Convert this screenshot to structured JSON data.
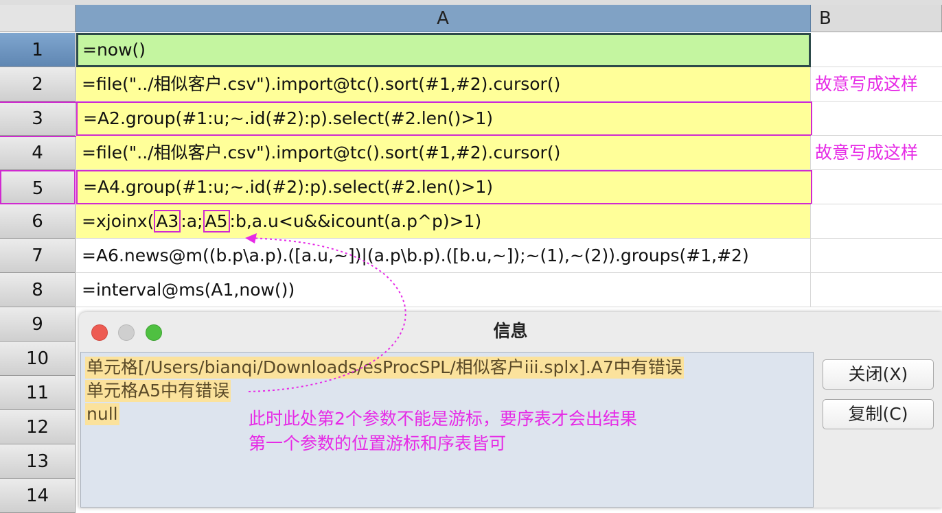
{
  "sheet": {
    "columns": [
      "A",
      "B"
    ],
    "rows": [
      {
        "num": "1",
        "formula": "=now()",
        "note": ""
      },
      {
        "num": "2",
        "formula": "=file(\"../相似客户.csv\").import@tc().sort(#1,#2).cursor()",
        "note": "故意写成这样"
      },
      {
        "num": "3",
        "formula": "=A2.group(#1:u;~.id(#2):p).select(#2.len()>1)",
        "note": ""
      },
      {
        "num": "4",
        "formula": "=file(\"../相似客户.csv\").import@tc().sort(#1,#2).cursor()",
        "note": "故意写成这样"
      },
      {
        "num": "5",
        "formula": "=A4.group(#1:u;~.id(#2):p).select(#2.len()>1)",
        "note": ""
      },
      {
        "num": "6",
        "formula_parts": [
          "=xjoinx(",
          "A3",
          ":a;",
          "A5",
          ":b,a.u<u&&icount(a.p^p)>1)"
        ],
        "note": ""
      },
      {
        "num": "7",
        "formula": "=A6.news@m((b.p\\a.p).([a.u,~])|(a.p\\b.p).([b.u,~]);~(1),~(2)).groups(#1,#2)",
        "note": ""
      },
      {
        "num": "8",
        "formula": "=interval@ms(A1,now())",
        "note": ""
      },
      {
        "num": "9"
      },
      {
        "num": "10"
      },
      {
        "num": "11"
      },
      {
        "num": "12"
      },
      {
        "num": "13"
      },
      {
        "num": "14"
      }
    ]
  },
  "dialog": {
    "title": "信息",
    "messages": [
      "单元格[/Users/bianqi/Downloads/esProcSPL/相似客户iii.splx].A7中有错误",
      "单元格A5中有错误",
      "null"
    ],
    "close_label": "关闭(X)",
    "copy_label": "复制(C)"
  },
  "annotation": {
    "line1": "此时此处第2个参数不能是游标，要序表才会出结果",
    "line2": "第一个参数的位置游标和序表皆可"
  },
  "colors": {
    "highlight": "#e62ae6",
    "cell_yellow": "#ffff99",
    "cell_green": "#c4f5a0",
    "col_header": "#80a2c5"
  }
}
